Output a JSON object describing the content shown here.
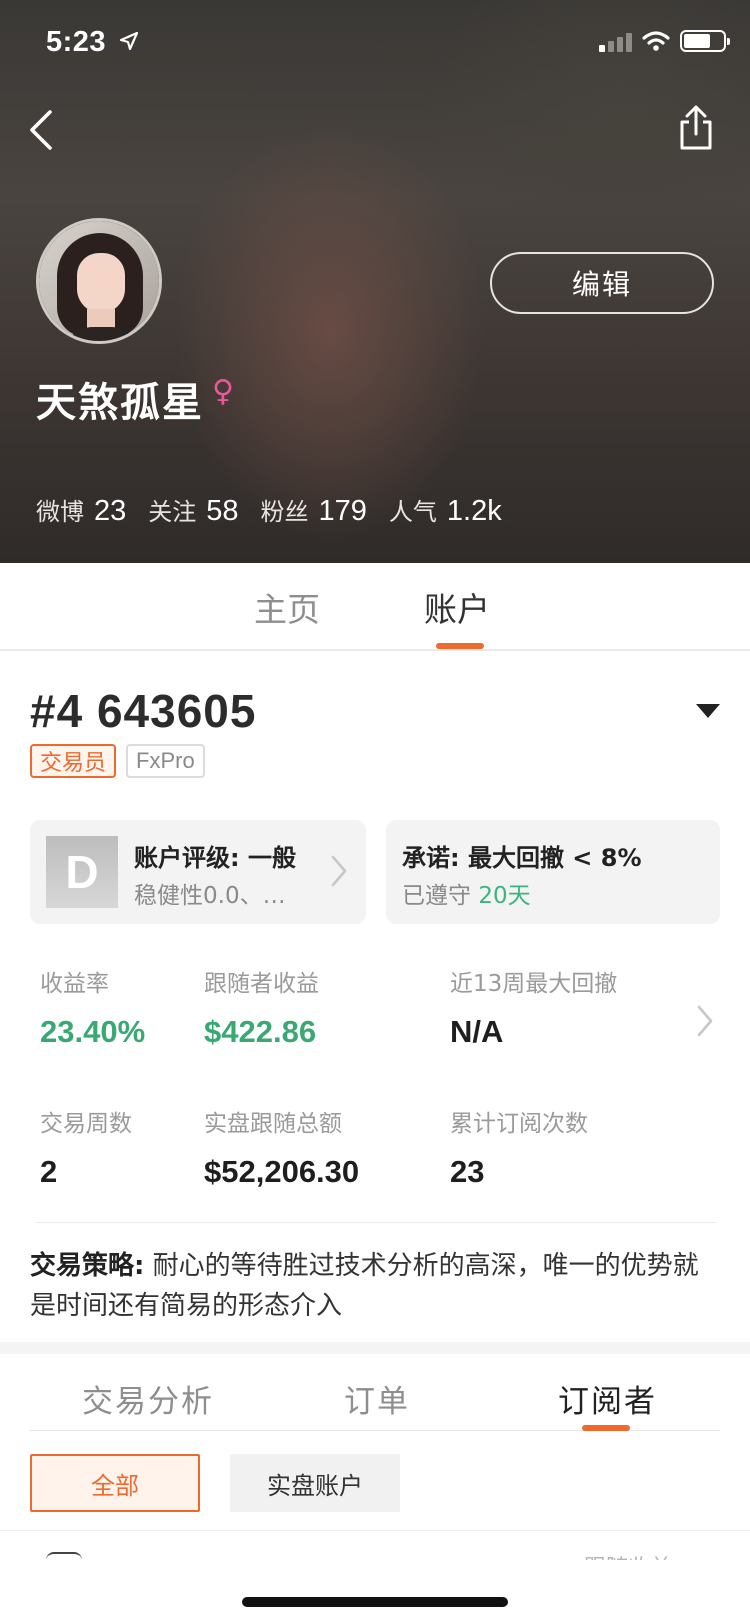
{
  "status_bar": {
    "time": "5:23"
  },
  "profile": {
    "username": "天煞孤星",
    "gender_symbol": "♀",
    "edit_label": "编辑",
    "stats": [
      {
        "label": "微博",
        "value": "23"
      },
      {
        "label": "关注",
        "value": "58"
      },
      {
        "label": "粉丝",
        "value": "179"
      },
      {
        "label": "人气",
        "value": "1.2k"
      }
    ]
  },
  "top_tabs": [
    {
      "label": "主页",
      "active": false
    },
    {
      "label": "账户",
      "active": true
    }
  ],
  "account": {
    "number": "#4  643605",
    "tags": [
      "交易员",
      "FxPro"
    ],
    "rating_card": {
      "grade": "D",
      "title": "账户评级: 一般",
      "subtitle": "稳健性0.0、…"
    },
    "promise_card": {
      "title": "承诺: 最大回撤 < 8%",
      "kept_prefix": "已遵守",
      "kept_days": "20天"
    },
    "metrics": [
      {
        "label": "收益率",
        "value": "23.40%",
        "color": "#3aa873"
      },
      {
        "label": "跟随者收益",
        "value": "$422.86",
        "color": "#3aa873"
      },
      {
        "label": "近13周最大回撤",
        "value": "N/A",
        "color": "#1e1e1e"
      },
      {
        "label": "交易周数",
        "value": "2",
        "color": "#1e1e1e"
      },
      {
        "label": "实盘跟随总额",
        "value": "$52,206.30",
        "color": "#1e1e1e"
      },
      {
        "label": "累计订阅次数",
        "value": "23",
        "color": "#1e1e1e"
      }
    ],
    "strategy_label": "交易策略:",
    "strategy_text": " 耐心的等待胜过技术分析的高深，唯一的优势就是时间还有简易的形态介入"
  },
  "sub_tabs": [
    {
      "label": "交易分析",
      "active": false
    },
    {
      "label": "订单",
      "active": false
    },
    {
      "label": "订阅者",
      "active": true
    }
  ],
  "filters": [
    {
      "label": "全部",
      "active": true
    },
    {
      "label": "实盘账户",
      "active": false
    }
  ],
  "peek_label": "跟随收益",
  "colors": {
    "accent": "#ee6a2c",
    "positive": "#3aa873",
    "female": "#e9589a"
  }
}
